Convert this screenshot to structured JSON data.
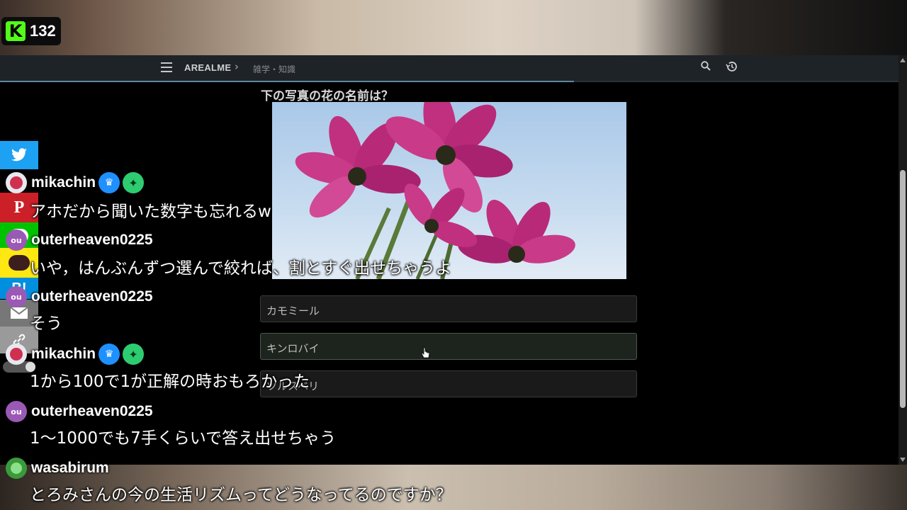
{
  "stream": {
    "viewer_count": "132"
  },
  "nav": {
    "brand": "AREALME",
    "breadcrumb": "雑学・知識"
  },
  "quiz": {
    "question": "下の写真の花の名前は？",
    "options": [
      "カモミール",
      "キンロバイ",
      "ツルスベリ"
    ]
  },
  "chat": [
    {
      "user": "mikachin",
      "message": "アホだから聞いた数字も忘れるw"
    },
    {
      "user": "outerheaven0225",
      "avatar_text": "ou",
      "message": "いや，はんぶんずつ選んで絞れば、割とすぐ出せちゃうよ"
    },
    {
      "user": "outerheaven0225",
      "avatar_text": "ou",
      "message": "そう"
    },
    {
      "user": "mikachin",
      "message": "1から100で1が正解の時おもろかった"
    },
    {
      "user": "outerheaven0225",
      "avatar_text": "ou",
      "message": "1～1000でも7手くらいで答え出せちゃう"
    },
    {
      "user": "wasabirum",
      "message": "とろみさんの今の生活リズムってどうなってるのですか？"
    }
  ],
  "share_icons": [
    "twitter-icon",
    "pinterest-icon",
    "line-icon",
    "kakaotalk-icon",
    "hatena-icon",
    "mail-icon",
    "link-icon"
  ],
  "colors": {
    "kick_green": "#53fc18",
    "navbar": "#1e2328",
    "avatar_ou": "#9b59b6",
    "badge_blue": "#1e90ff",
    "badge_green": "#2ecc71"
  }
}
